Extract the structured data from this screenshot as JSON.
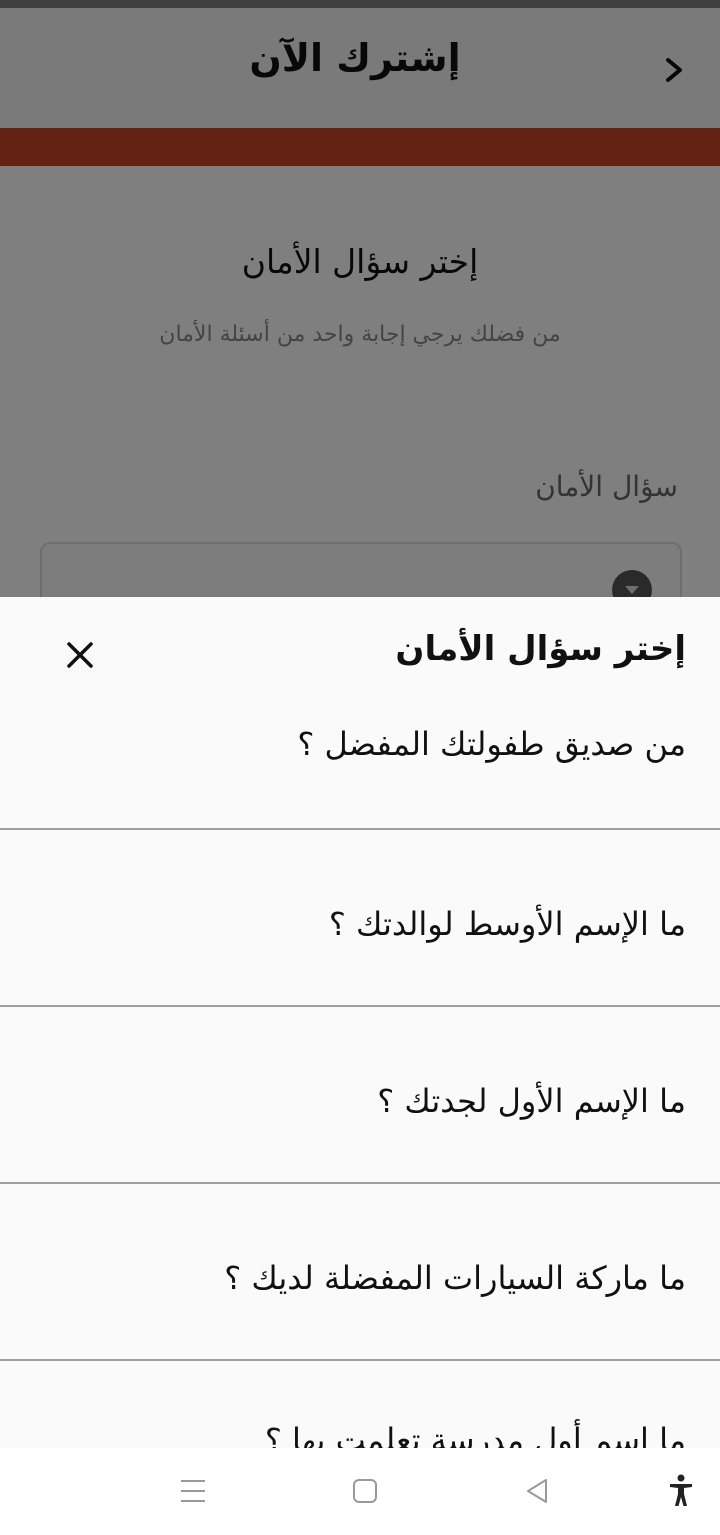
{
  "header": {
    "title": "إشترك الآن"
  },
  "page": {
    "heading": "إختر سؤال الأمان",
    "subtitle": "من فضلك يرجي إجابة واحد من أسئلة الأمان",
    "field_label": "سؤال الأمان"
  },
  "sheet": {
    "title": "إختر سؤال الأمان",
    "options": [
      "من صديق طفولتك المفضل ؟",
      "ما الإسم الأوسط لوالدتك ؟",
      "ما الإسم الأول لجدتك ؟",
      "ما ماركة السيارات المفضلة لديك ؟",
      "ما إسم أول مدرسة تعلمت بها ؟"
    ]
  },
  "icons": {
    "back": "chevron-right-icon",
    "close": "close-icon",
    "dropdown": "dropdown-arrow-icon",
    "nav_menu": "menu-lines-icon",
    "nav_home": "home-square-icon",
    "nav_back": "back-triangle-icon",
    "accessibility": "accessibility-icon"
  },
  "colors": {
    "accent": "#c8452a",
    "scrim": "rgba(0,0,0,0.5)"
  }
}
